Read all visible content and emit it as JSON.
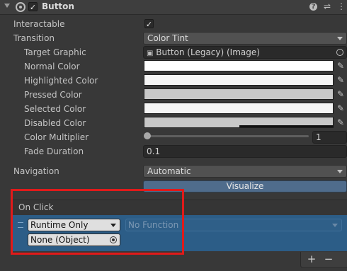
{
  "header": {
    "component_name": "Button",
    "enabled": true,
    "icons": [
      "foldout-arrow-icon",
      "component-icon",
      "help-icon",
      "presets-icon",
      "kebab-menu-icon"
    ]
  },
  "fields": {
    "interactable": {
      "label": "Interactable",
      "checked": true
    },
    "transition": {
      "label": "Transition",
      "value": "Color Tint"
    },
    "target_graphic": {
      "label": "Target Graphic",
      "value": "Button (Legacy) (Image)"
    },
    "normal_color": {
      "label": "Normal Color",
      "color": "#ffffff"
    },
    "highlighted_color": {
      "label": "Highlighted Color",
      "color": "#f5f5f5"
    },
    "pressed_color": {
      "label": "Pressed Color",
      "color": "#c8c8c8"
    },
    "selected_color": {
      "label": "Selected Color",
      "color": "#f5f5f5"
    },
    "disabled_color": {
      "label": "Disabled Color",
      "color": "#c8c8c8"
    },
    "color_multiplier": {
      "label": "Color Multiplier",
      "value": "1"
    },
    "fade_duration": {
      "label": "Fade Duration",
      "value": "0.1"
    },
    "navigation": {
      "label": "Navigation",
      "value": "Automatic"
    },
    "visualize": {
      "label": "Visualize"
    }
  },
  "on_click": {
    "title": "On Click",
    "call_state": "Runtime Only",
    "function": "No Function",
    "target": "None (Object)"
  },
  "footer": {
    "add_label": "+",
    "remove_label": "−"
  },
  "colors": {
    "accent": "#2c5d87",
    "highlight_box": "#e11a1a",
    "background": "#383838"
  }
}
